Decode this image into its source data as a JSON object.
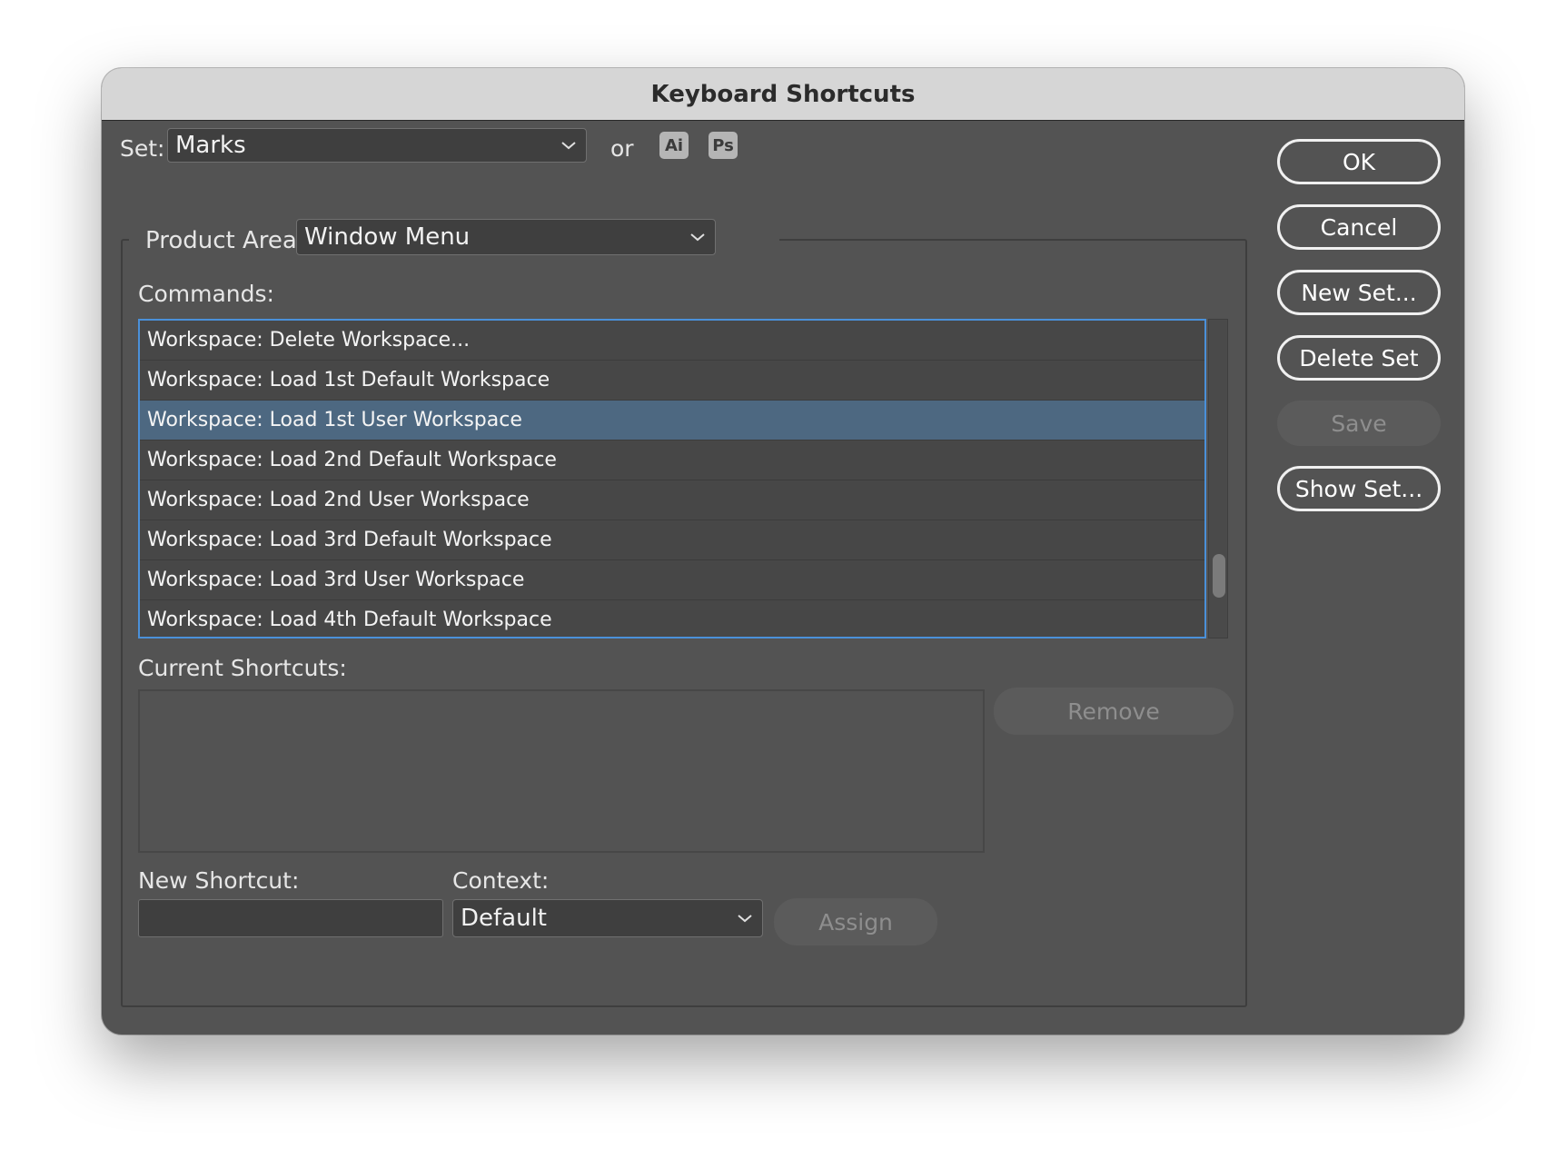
{
  "window": {
    "title": "Keyboard Shortcuts"
  },
  "set": {
    "label": "Set:",
    "value": "Marks",
    "or_label": "or",
    "app_icons": [
      "Ai",
      "Ps"
    ]
  },
  "product_area": {
    "label": "Product Area:",
    "value": "Window Menu"
  },
  "commands": {
    "label": "Commands:",
    "items": [
      "Workspace: Delete Workspace...",
      "Workspace: Load 1st Default Workspace",
      "Workspace: Load 1st User Workspace",
      "Workspace: Load 2nd Default Workspace",
      "Workspace: Load 2nd User Workspace",
      "Workspace: Load 3rd Default Workspace",
      "Workspace: Load 3rd User Workspace",
      "Workspace: Load 4th Default Workspace"
    ],
    "selected_index": 2
  },
  "current_shortcuts": {
    "label": "Current Shortcuts:",
    "remove_label": "Remove"
  },
  "new_shortcut": {
    "label": "New Shortcut:",
    "value": ""
  },
  "context": {
    "label": "Context:",
    "value": "Default"
  },
  "assign_label": "Assign",
  "side_buttons": {
    "ok": "OK",
    "cancel": "Cancel",
    "new_set": "New Set...",
    "delete_set": "Delete Set",
    "save": "Save",
    "show_set": "Show Set..."
  },
  "colors": {
    "selection": "#4d6881",
    "list_focus_border": "#4a90d9",
    "dialog_bg": "#535353"
  }
}
